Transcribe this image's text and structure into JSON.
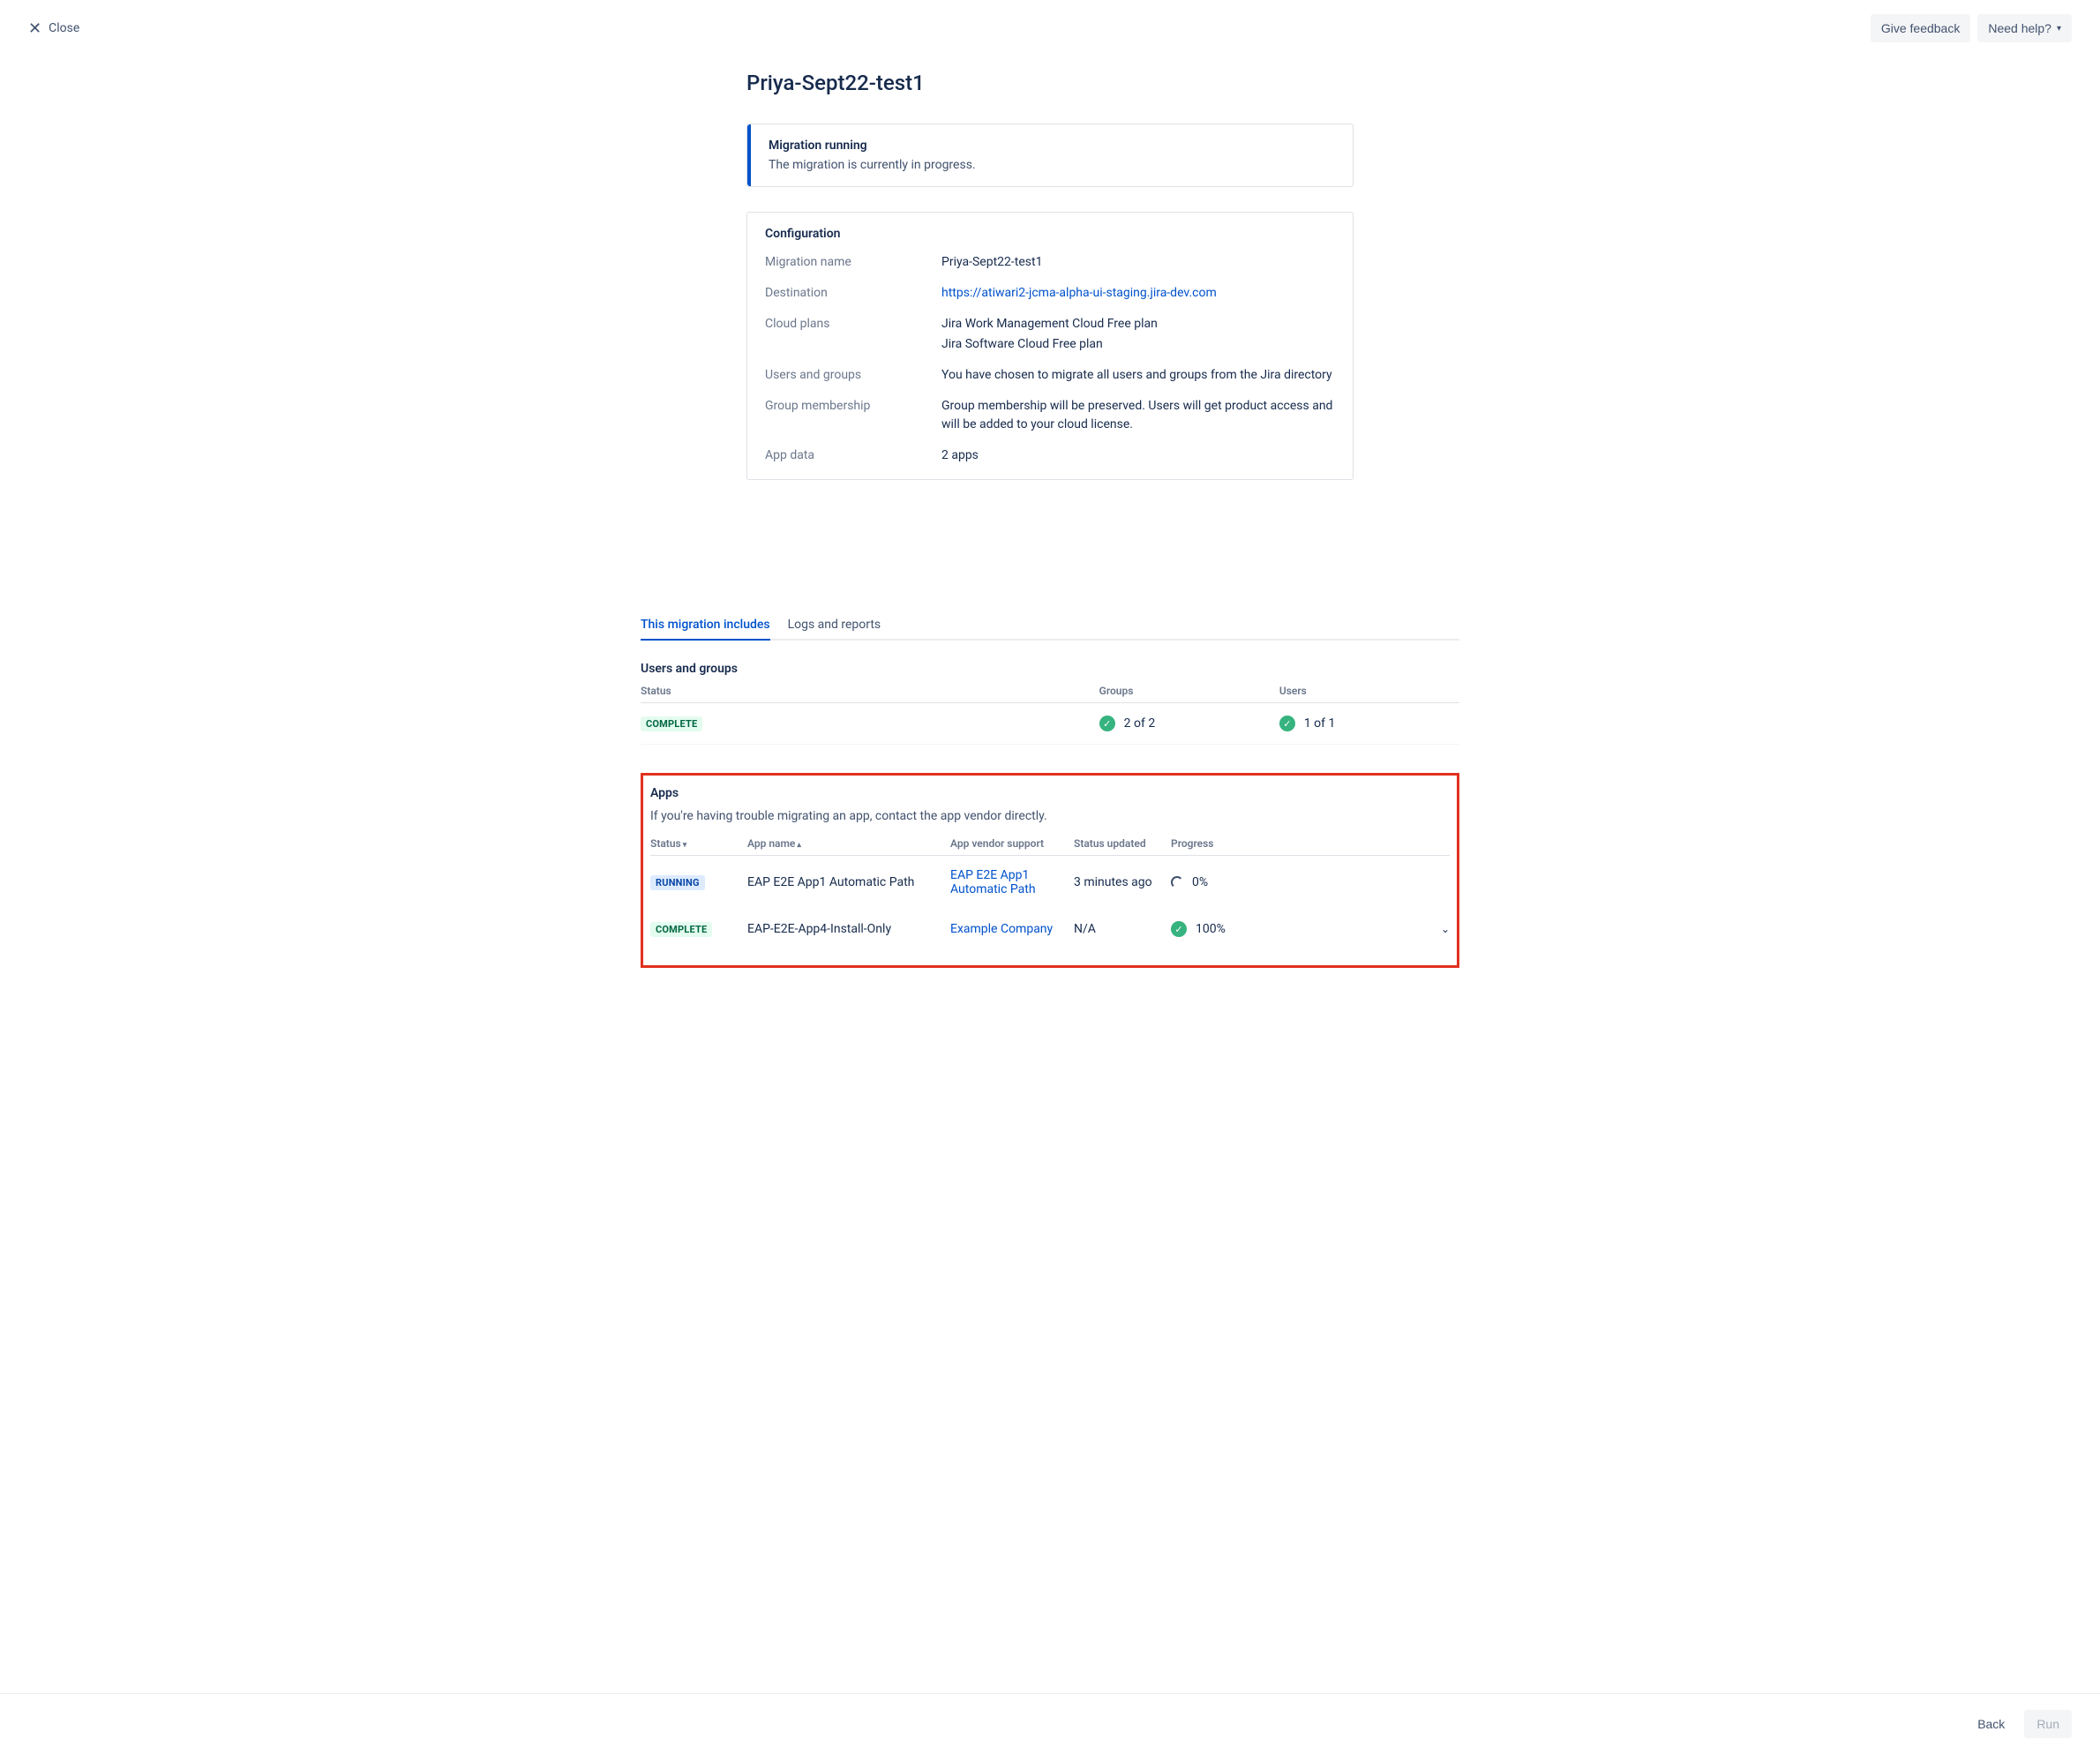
{
  "header": {
    "close_label": "Close",
    "give_feedback": "Give feedback",
    "need_help": "Need help?"
  },
  "page": {
    "title": "Priya-Sept22-test1"
  },
  "info_panel": {
    "title": "Migration running",
    "desc": "The migration is currently in progress."
  },
  "config": {
    "title": "Configuration",
    "rows": {
      "migration_name": {
        "label": "Migration name",
        "value": "Priya-Sept22-test1"
      },
      "destination": {
        "label": "Destination",
        "value": "https://atiwari2-jcma-alpha-ui-staging.jira-dev.com"
      },
      "cloud_plans": {
        "label": "Cloud plans",
        "value1": "Jira Work Management Cloud Free plan",
        "value2": "Jira Software Cloud Free plan"
      },
      "users_groups": {
        "label": "Users and groups",
        "value": "You have chosen to migrate all users and groups from the Jira directory"
      },
      "group_membership": {
        "label": "Group membership",
        "value": "Group membership will be preserved. Users will get product access and will be added to your cloud license."
      },
      "app_data": {
        "label": "App data",
        "value": "2 apps"
      }
    }
  },
  "tabs": {
    "this_migration": "This migration includes",
    "logs_reports": "Logs and reports"
  },
  "users_groups_section": {
    "title": "Users and groups",
    "headers": {
      "status": "Status",
      "groups": "Groups",
      "users": "Users"
    },
    "row": {
      "status": "COMPLETE",
      "groups": "2 of 2",
      "users": "1 of 1"
    }
  },
  "apps_section": {
    "title": "Apps",
    "hint": "If you're having trouble migrating an app, contact the app vendor directly.",
    "headers": {
      "status": "Status",
      "app_name": "App name",
      "vendor": "App vendor support",
      "updated": "Status updated",
      "progress": "Progress"
    },
    "rows": [
      {
        "status": "RUNNING",
        "name": "EAP E2E App1 Automatic Path",
        "vendor": "EAP E2E App1 Automatic Path",
        "updated": "3 minutes ago",
        "progress": "0%"
      },
      {
        "status": "COMPLETE",
        "name": "EAP-E2E-App4-Install-Only",
        "vendor": "Example Company",
        "updated": "N/A",
        "progress": "100%"
      }
    ]
  },
  "footer": {
    "back": "Back",
    "run": "Run"
  }
}
